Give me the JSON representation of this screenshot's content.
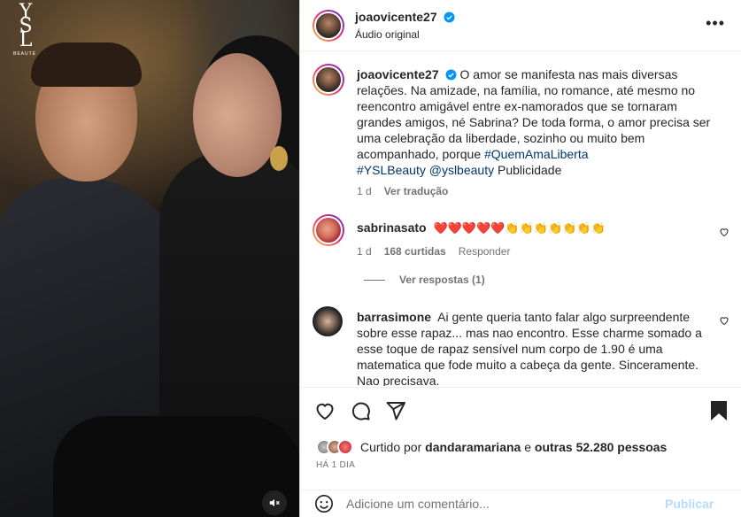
{
  "post_author": {
    "username": "joaovicente27",
    "audio": "Áudio original"
  },
  "caption": {
    "username": "joaovicente27",
    "text": "O amor se manifesta nas mais diversas relações. Na amizade, na família, no romance, até mesmo no reencontro amigável entre ex-namorados que se tornaram grandes amigos, né Sabrina? De toda forma, o amor precisa ser uma celebração da liberdade, sozinho ou muito bem acompanhado, porque ",
    "tag1": "#QuemAmaLiberta",
    "tag2": "#YSLBeauty",
    "mention": "@yslbeauty",
    "suffix": " Publicidade",
    "age": "1 d",
    "translate": "Ver tradução"
  },
  "comments": [
    {
      "username": "sabrinasato",
      "text": "❤️❤️❤️❤️❤️👏👏👏👏👏👏👏",
      "age": "1 d",
      "likes": "168 curtidas",
      "reply": "Responder",
      "view_replies": "Ver respostas (1)"
    },
    {
      "username": "barrasimone",
      "text": "Ai gente queria tanto falar algo surpreendente sobre esse rapaz... mas nao encontro. Esse charme somado a esse toque de rapaz sensível num corpo de 1.90 é uma matematica que fode muito a cabeça da gente. Sinceramente. Nao precisava."
    }
  ],
  "likes": {
    "prefix": "Curtido por ",
    "user": "dandaramariana",
    "middle": " e ",
    "others": "outras 52.280 pessoas"
  },
  "date": "HÁ 1 DIA",
  "comment_box": {
    "placeholder": "Adicione um comentário...",
    "publish": "Publicar"
  },
  "brand": {
    "mono": "YSL",
    "sub": "BEAUTÉ"
  },
  "colors": {
    "verified": "#0095f6",
    "link": "#00376b",
    "publish_disabled": "#b3dbff",
    "muted_text": "#737373"
  }
}
